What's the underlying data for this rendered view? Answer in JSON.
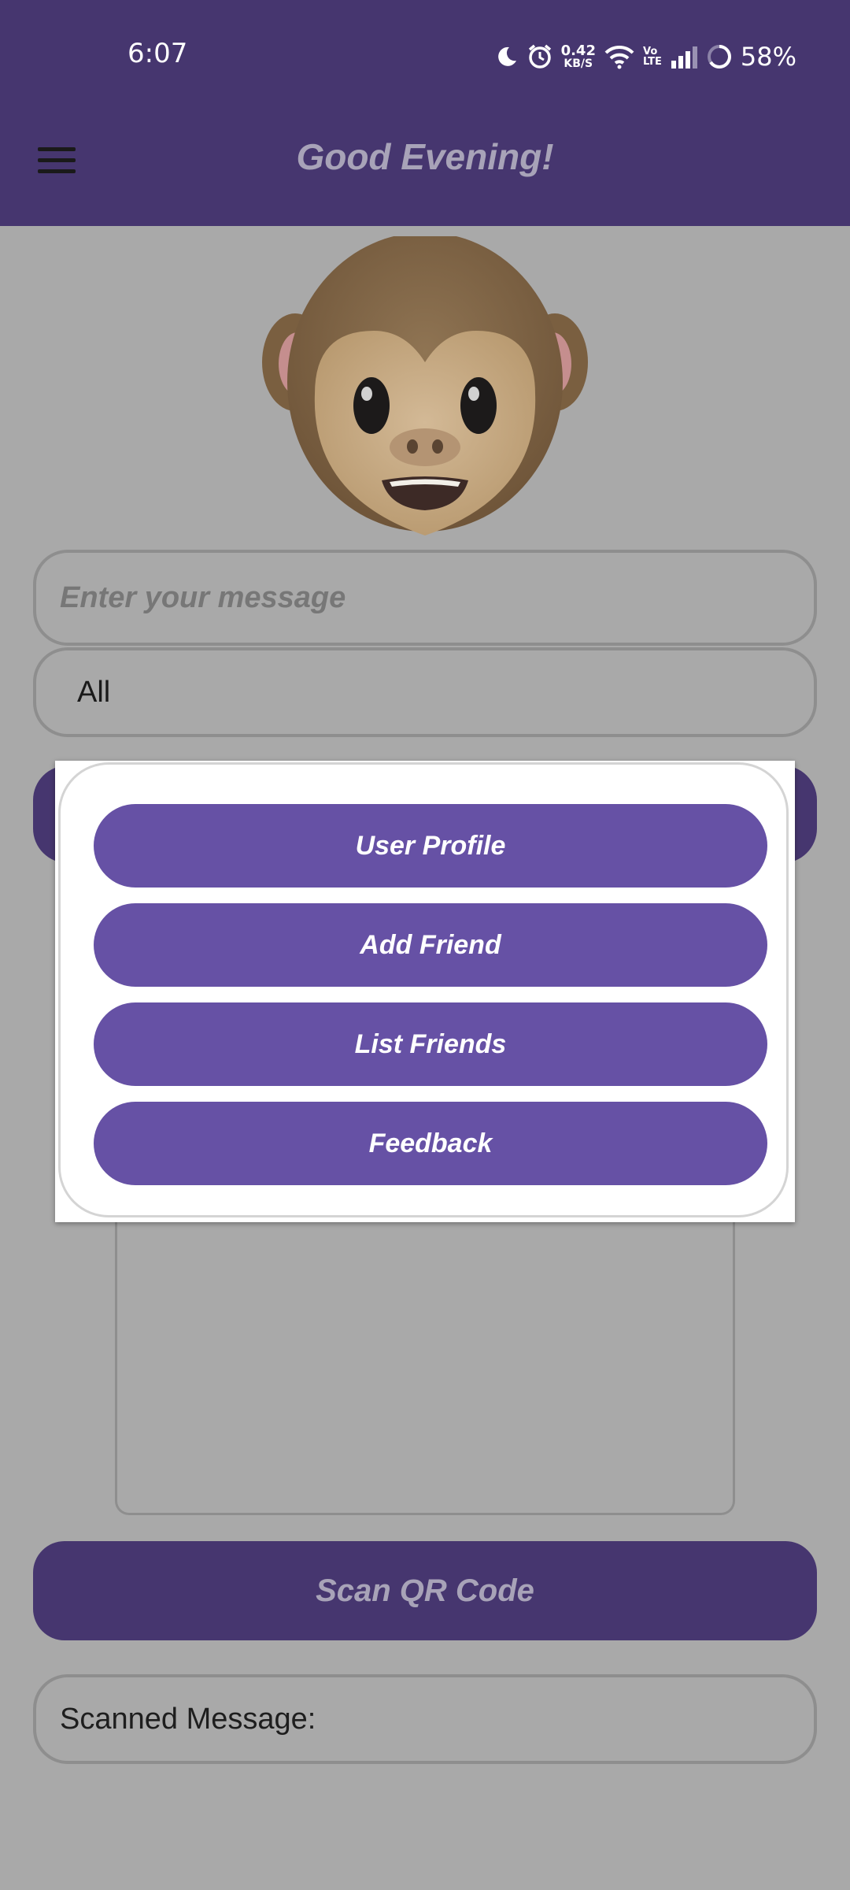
{
  "status_bar": {
    "time": "6:07",
    "net_speed_value": "0.42",
    "net_speed_unit": "KB/S",
    "volte_top": "Vo",
    "volte_bottom": "LTE",
    "battery": "58%",
    "icons": [
      "moon-icon",
      "alarm-icon",
      "wifi-icon",
      "volte-icon",
      "signal-icon",
      "battery-icon"
    ]
  },
  "app_bar": {
    "title": "Good Evening!",
    "menu_icon": "hamburger-menu-icon"
  },
  "avatar": {
    "icon": "monkey-emoji-avatar"
  },
  "message_input": {
    "placeholder": "Enter your message"
  },
  "recipient_select": {
    "selected": "All"
  },
  "popup_menu": {
    "items": [
      {
        "label": "User Profile"
      },
      {
        "label": "Add Friend"
      },
      {
        "label": "List Friends"
      },
      {
        "label": "Feedback"
      }
    ]
  },
  "scan_button": {
    "label": "Scan QR Code"
  },
  "scanned_message": {
    "label": "Scanned Message:"
  },
  "colors": {
    "app_bar": "#46366f",
    "popup_button": "#6651a5",
    "dim_background": "#a9a9a9",
    "title_text": "#a8a3b8"
  }
}
